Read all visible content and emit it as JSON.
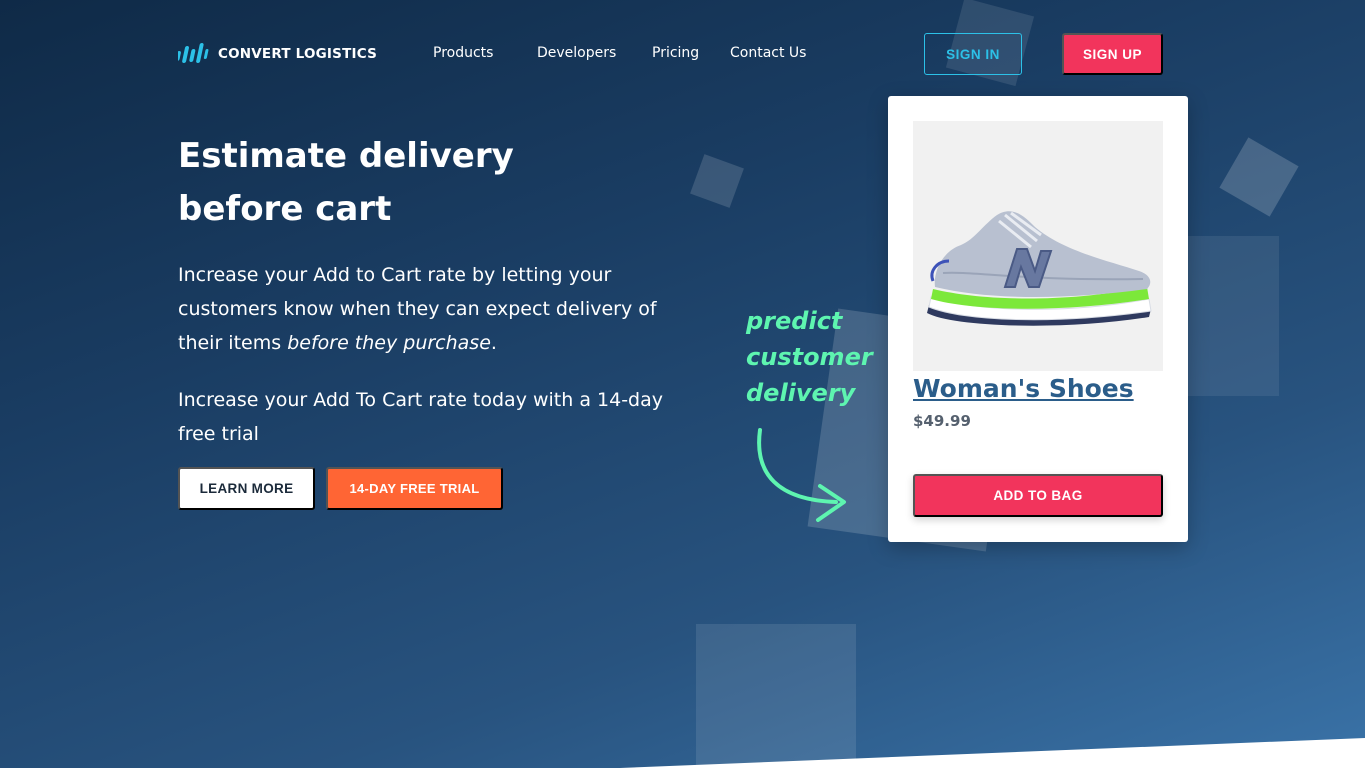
{
  "brand": {
    "name": "CONVERT LOGISTICS",
    "icon": "sound-bars-logo-icon",
    "accent": "#2cc1e8"
  },
  "nav": {
    "links": [
      "Products",
      "Developers",
      "Pricing",
      "Contact Us"
    ],
    "sign_in": "SIGN IN",
    "sign_up": "SIGN UP"
  },
  "hero": {
    "title": "Estimate delivery before cart",
    "paragraph1_prefix": "Increase your Add to Cart rate by letting your customers know when they can expect delivery of their items ",
    "paragraph1_emphasis": "before they purchase",
    "paragraph1_suffix": ".",
    "paragraph2": "Increase your Add To Cart rate today with a 14-day free trial",
    "learn_more": "LEARN MORE",
    "free_trial": "14-DAY FREE TRIAL"
  },
  "annotation": {
    "lines": [
      "predict",
      "customer",
      "delivery"
    ],
    "icon": "curved-arrow-icon"
  },
  "product_card": {
    "image_icon": "running-shoe-icon",
    "title": "Woman's Shoes",
    "price": "$49.99",
    "add_to_bag": "ADD TO BAG"
  },
  "colors": {
    "primary_red": "#f2345c",
    "trial_orange": "#ff6534",
    "annotation_green": "#5ef5b0",
    "background_dark": "#0f2a47"
  }
}
